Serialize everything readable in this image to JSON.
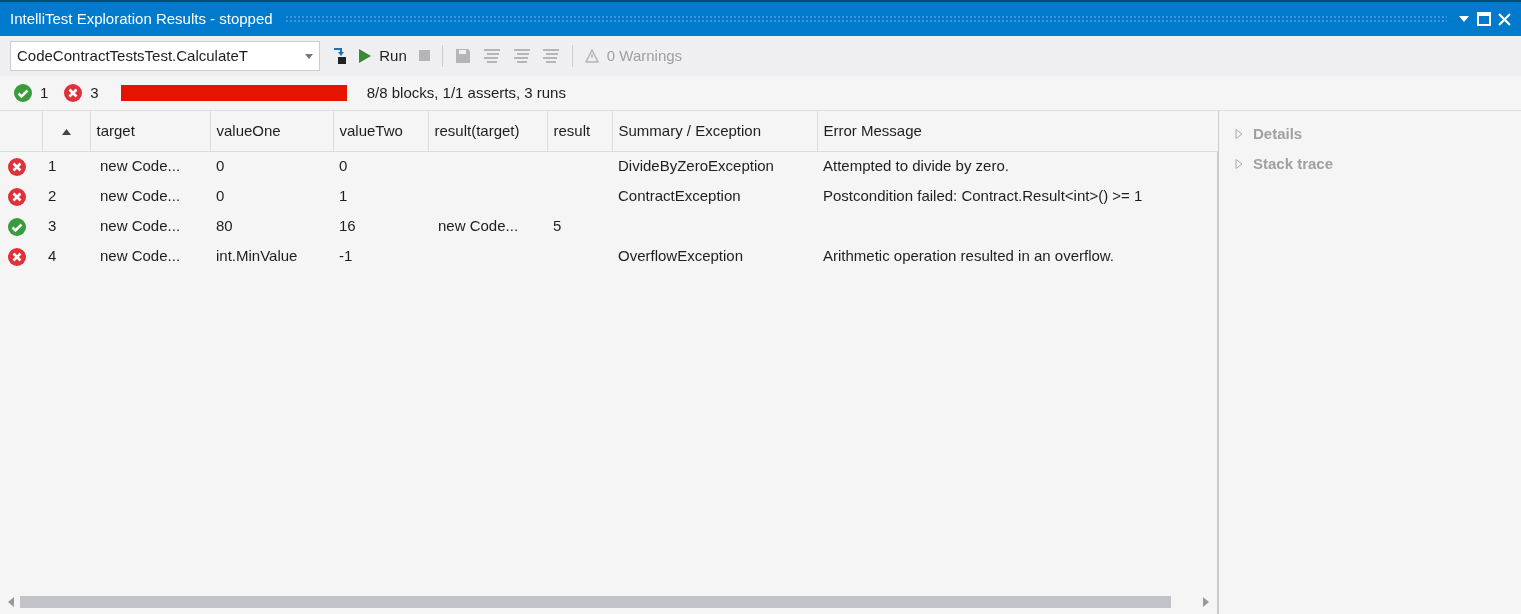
{
  "window": {
    "title": "IntelliTest Exploration Results - stopped"
  },
  "toolbar": {
    "method": "CodeContractTestsTest.CalculateT",
    "items": [
      {
        "kind": "goto",
        "disabled": false
      },
      {
        "kind": "run",
        "label": "Run",
        "disabled": false
      },
      {
        "kind": "stop",
        "disabled": true
      },
      {
        "kind": "sep"
      },
      {
        "kind": "save",
        "disabled": true
      },
      {
        "kind": "list",
        "disabled": true
      },
      {
        "kind": "list",
        "disabled": true
      },
      {
        "kind": "list",
        "disabled": true
      },
      {
        "kind": "sep"
      },
      {
        "kind": "warnings",
        "label": "0 Warnings",
        "disabled": true
      }
    ]
  },
  "summary": {
    "passed": "1",
    "failed": "3",
    "progress": {
      "level": 1
    },
    "text": "8/8 blocks, 1/1 asserts, 3 runs"
  },
  "table": {
    "columns": [
      "target",
      "valueOne",
      "valueTwo",
      "result(target)",
      "result",
      "Summary / Exception",
      "Error Message"
    ],
    "rows": [
      {
        "kind": "fail",
        "index": "1",
        "cells": [
          "new Code...",
          "0",
          "0",
          "",
          "",
          "DivideByZeroException",
          "Attempted to divide by zero."
        ]
      },
      {
        "kind": "fail",
        "index": "2",
        "cells": [
          "new Code...",
          "0",
          "1",
          "",
          "",
          "ContractException",
          "Postcondition failed: Contract.Result<int>() >= 1"
        ]
      },
      {
        "kind": "pass",
        "index": "3",
        "cells": [
          "new Code...",
          "80",
          "16",
          "new Code...",
          "5",
          "",
          ""
        ]
      },
      {
        "kind": "fail",
        "index": "4",
        "cells": [
          "new Code...",
          "int.MinValue",
          "-1",
          "",
          "",
          "OverflowException",
          "Arithmetic operation resulted in an overflow."
        ]
      }
    ]
  },
  "details": [
    {
      "label": "Details",
      "expanded": false
    },
    {
      "label": "Stack trace",
      "expanded": false
    }
  ]
}
